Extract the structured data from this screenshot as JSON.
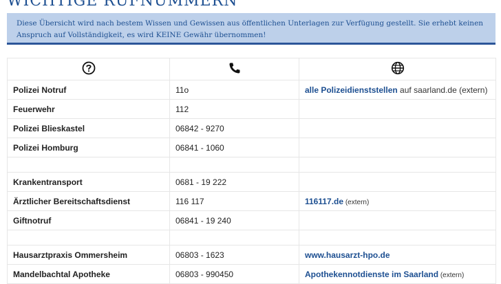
{
  "page_title": "WICHTIGE RUFNUMMERN",
  "notice": "Diese Übersicht wird nach bestem Wissen und Gewissen aus öffentlichen Unterlagen zur Verfügung gestellt. Sie erhebt keinen Anspruch auf Vollständigkeit, es wird KEINE Gewähr übernommen!",
  "header_icons": [
    "question-icon",
    "phone-icon",
    "globe-icon"
  ],
  "rows": [
    {
      "name": "Polizei Notruf",
      "phone": "11o",
      "link": "alle Polizeidienststellen",
      "suffix": " auf saarland.de (extern)"
    },
    {
      "name": "Feuerwehr",
      "phone": "112",
      "link": "",
      "suffix": ""
    },
    {
      "name": "Polizei Blieskastel",
      "phone": "06842 - 9270",
      "link": "",
      "suffix": ""
    },
    {
      "name": "Polizei Homburg",
      "phone": "06841 - 1060",
      "link": "",
      "suffix": ""
    },
    {
      "name": "",
      "phone": "",
      "link": "",
      "suffix": ""
    },
    {
      "name": "Krankentransport",
      "phone": "0681 - 19 222",
      "link": "",
      "suffix": ""
    },
    {
      "name": "Ärztlicher Bereitschaftsdienst",
      "phone": "116 117",
      "link": "116117.de",
      "suffix": " (extern)"
    },
    {
      "name": "Giftnotruf",
      "phone": "06841 - 19 240",
      "link": "",
      "suffix": ""
    },
    {
      "name": "",
      "phone": "",
      "link": "",
      "suffix": ""
    },
    {
      "name": "Hausarztpraxis Ommersheim",
      "phone": "06803 - 1623",
      "link": "www.hausarzt-hpo.de",
      "suffix": ""
    },
    {
      "name": "Mandelbachtal Apotheke",
      "phone": "06803 - 990450",
      "link": "Apothekennotdienste im Saarland",
      "suffix": " (extern)"
    }
  ]
}
